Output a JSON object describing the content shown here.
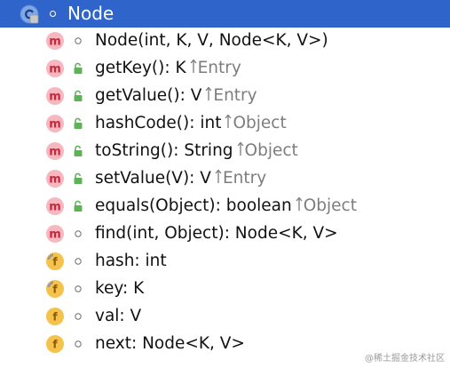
{
  "header": {
    "class_name": "Node",
    "class_icon": "class-icon",
    "visibility_icon": "package-private-icon",
    "colors": {
      "background": "#2f65ca",
      "text": "#ffffff"
    }
  },
  "members": [
    {
      "kind": "method",
      "icon": "method-icon",
      "visibility": "package-private-icon",
      "text": "Node(int, K, V, Node<K, V>)",
      "owner": ""
    },
    {
      "kind": "method",
      "icon": "method-icon",
      "visibility": "public-icon",
      "text": "getKey(): K",
      "owner": "Entry"
    },
    {
      "kind": "method",
      "icon": "method-icon",
      "visibility": "public-icon",
      "text": "getValue(): V",
      "owner": "Entry"
    },
    {
      "kind": "method",
      "icon": "method-icon",
      "visibility": "public-icon",
      "text": "hashCode(): int",
      "owner": "Object"
    },
    {
      "kind": "method",
      "icon": "method-icon",
      "visibility": "public-icon",
      "text": "toString(): String",
      "owner": "Object"
    },
    {
      "kind": "method",
      "icon": "method-icon",
      "visibility": "public-icon",
      "text": "setValue(V): V",
      "owner": "Entry"
    },
    {
      "kind": "method",
      "icon": "method-icon",
      "visibility": "public-icon",
      "text": "equals(Object): boolean",
      "owner": "Object"
    },
    {
      "kind": "method",
      "icon": "method-icon",
      "visibility": "package-private-icon",
      "text": "find(int, Object): Node<K, V>",
      "owner": ""
    },
    {
      "kind": "field",
      "icon": "final-field-icon",
      "visibility": "package-private-icon",
      "text": "hash: int",
      "owner": ""
    },
    {
      "kind": "field",
      "icon": "final-field-icon",
      "visibility": "package-private-icon",
      "text": "key: K",
      "owner": ""
    },
    {
      "kind": "field",
      "icon": "field-icon",
      "visibility": "package-private-icon",
      "text": "val: V",
      "owner": ""
    },
    {
      "kind": "field",
      "icon": "field-icon",
      "visibility": "package-private-icon",
      "text": "next: Node<K, V>",
      "owner": ""
    }
  ],
  "watermark": "@稀土掘金技术社区",
  "colors": {
    "method_icon_bg": "#f6b7bf",
    "method_icon_letter": "#c5283d",
    "field_icon_bg": "#f5c24c",
    "field_icon_letter": "#8a5a00",
    "public_lock": "#5fb257",
    "owner_text": "#7d7d7d"
  }
}
